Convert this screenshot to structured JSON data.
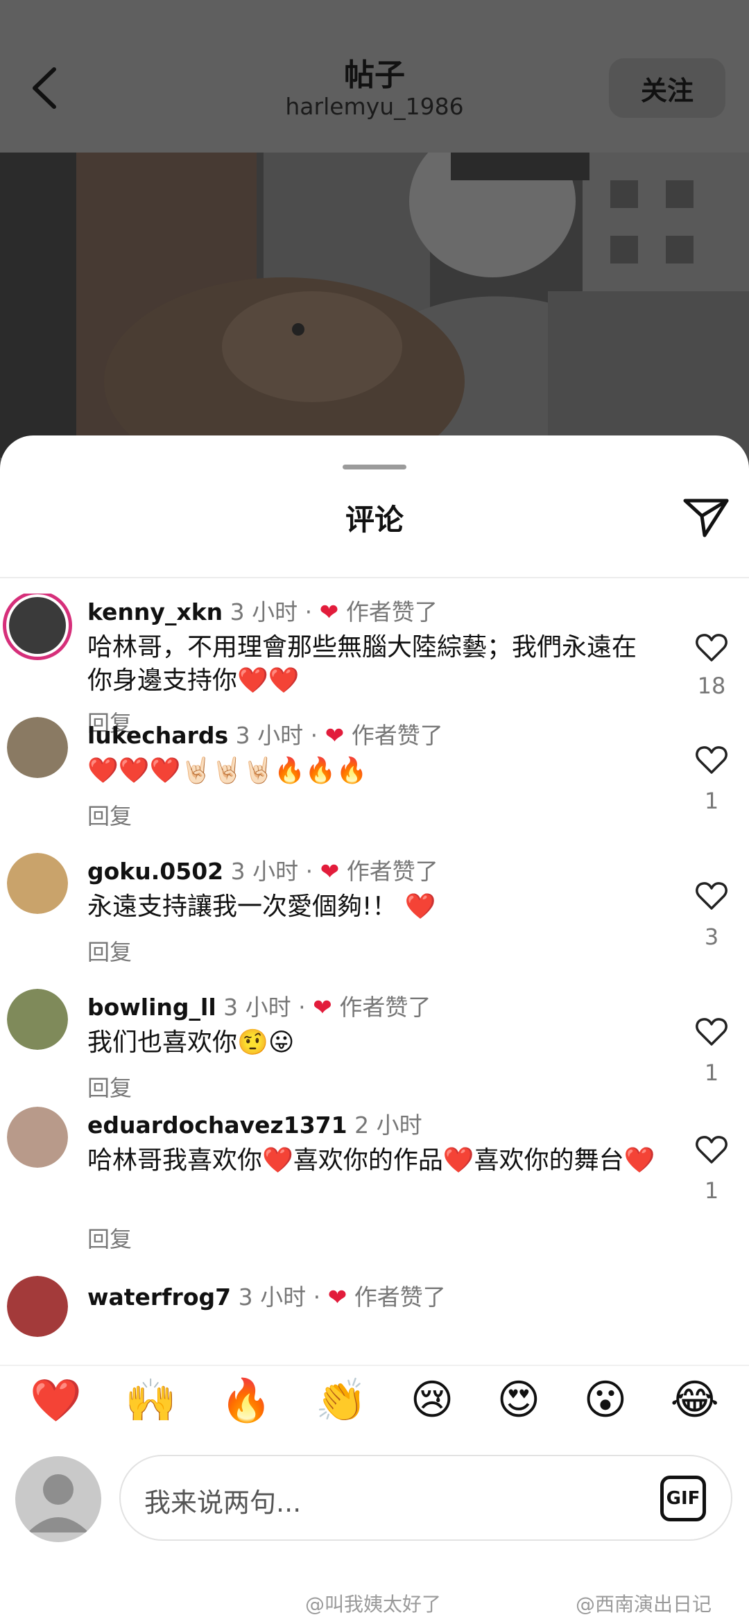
{
  "header": {
    "title": "帖子",
    "username": "harlemyu_1986",
    "follow_label": "关注"
  },
  "sheet": {
    "title": "评论"
  },
  "comments": [
    {
      "username": "kenny_xkn",
      "time": "3 小时",
      "separator": "·",
      "author_liked": "作者赞了",
      "text": "哈林哥，不用理會那些無腦大陸綜藝；我們永遠在你身邊支持你❤️❤️",
      "reply": "回复",
      "likes": "18"
    },
    {
      "username": "lukechards",
      "time": "3 小时",
      "separator": "·",
      "author_liked": "作者赞了",
      "text": "❤️❤️❤️🤘🏻🤘🏻🤘🏻🔥🔥🔥",
      "reply": "回复",
      "likes": "1"
    },
    {
      "username": "goku.0502",
      "time": "3 小时",
      "separator": "·",
      "author_liked": "作者赞了",
      "text": "永遠支持讓我一次愛個夠!！ ❤️",
      "reply": "回复",
      "likes": "3"
    },
    {
      "username": "bowling_ll",
      "time": "3 小时",
      "separator": "·",
      "author_liked": "作者赞了",
      "text": "我们也喜欢你🤨😛",
      "reply": "回复",
      "likes": "1"
    },
    {
      "username": "eduardochavez1371",
      "time": "2 小时",
      "text": "哈林哥我喜欢你❤️喜欢你的作品❤️喜欢你的舞台❤️",
      "reply": "回复",
      "likes": "1"
    },
    {
      "username": "waterfrog7",
      "time": "3 小时",
      "separator": "·",
      "author_liked": "作者赞了"
    }
  ],
  "emoji_bar": [
    "❤️",
    "🙌",
    "🔥",
    "👏",
    "😢",
    "😍",
    "😮",
    "😂"
  ],
  "input": {
    "placeholder": "我来说两句...",
    "gif_label": "GIF"
  },
  "watermarks": {
    "left": "@叫我姨太好了",
    "right": "@西南演出日记"
  },
  "colors": {
    "heart": "#e21c3b",
    "story_ring": "#d62f7a",
    "muted_text": "#777777"
  }
}
